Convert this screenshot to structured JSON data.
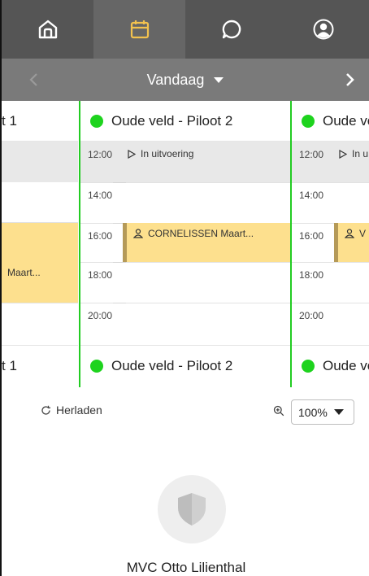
{
  "nav": {
    "tabs": [
      {
        "icon": "home-icon"
      },
      {
        "icon": "calendar-icon",
        "active": true
      },
      {
        "icon": "chat-icon"
      },
      {
        "icon": "user-icon"
      }
    ],
    "accent_color": "#f3c24e"
  },
  "datebar": {
    "label": "Vandaag"
  },
  "schedule": {
    "left_column": {
      "header": "t 1",
      "event_label": "Maart..."
    },
    "middle_column": {
      "header": "Oude veld - Piloot 2",
      "times": [
        "12:00",
        "14:00",
        "16:00",
        "18:00",
        "20:00"
      ],
      "status": "In uitvoering",
      "event_label": "CORNELISSEN Maart..."
    },
    "right_column": {
      "header": "Oude ve",
      "times": [
        "12:00",
        "14:00",
        "16:00",
        "18:00",
        "20:00"
      ],
      "status": "In u",
      "event_label": "V"
    },
    "status_color": "#1ed31e",
    "event_color": "#fde08e"
  },
  "tools": {
    "reload_label": "Herladen",
    "zoom_value": "100%"
  },
  "club": {
    "name": "MVC Otto Lilienthal"
  }
}
